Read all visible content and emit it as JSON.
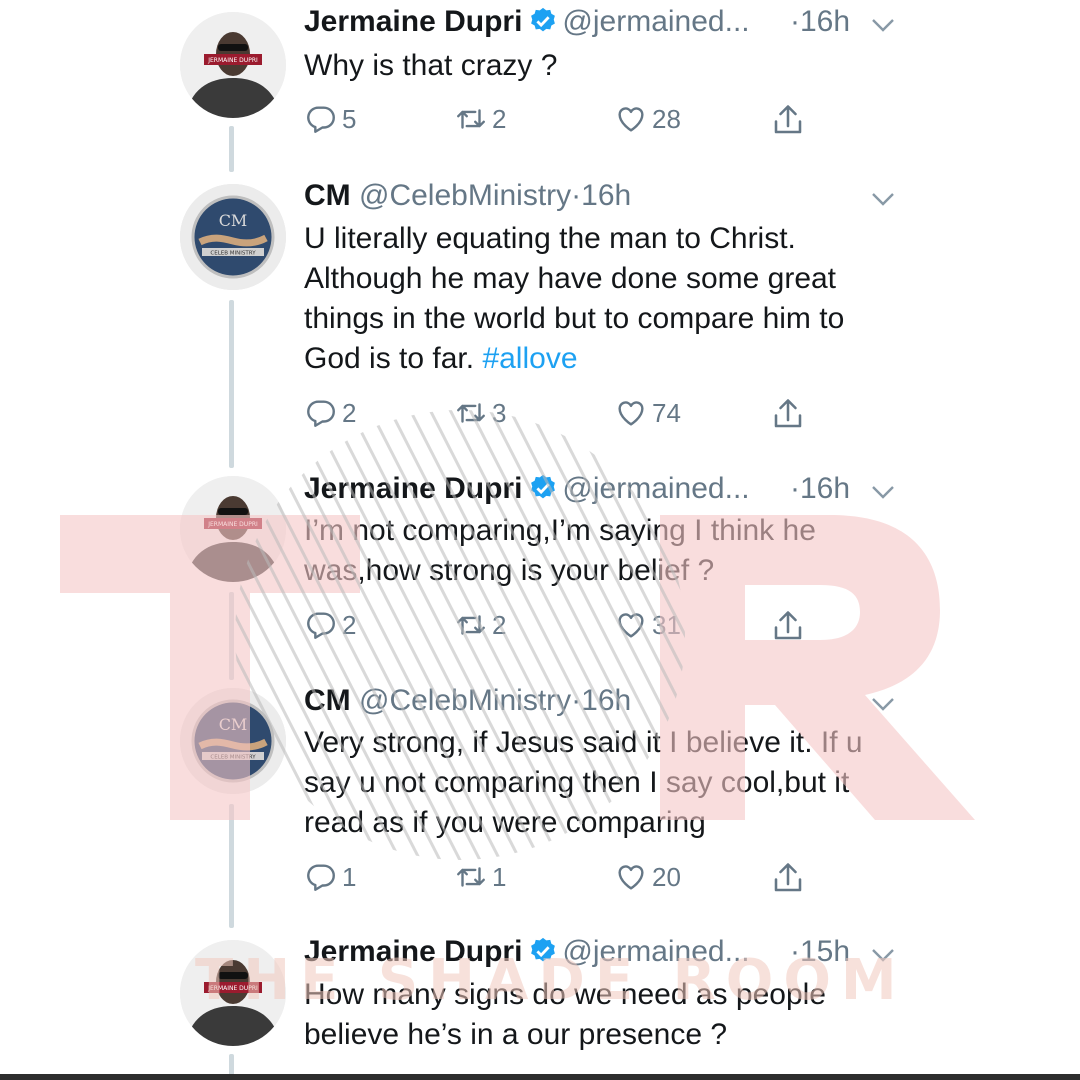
{
  "tweets": [
    {
      "name": "Jermaine Dupri",
      "handle": "@jermained...",
      "dot": "·",
      "time": "16h",
      "text": "Why is that crazy ?",
      "hashtag": "",
      "reply": "5",
      "retweet": "2",
      "like": "28",
      "avatar_text": "JERMAINE DUPRI"
    },
    {
      "name": "CM",
      "handle": "@CelebMinistry",
      "dot": "·",
      "time": "16h",
      "text": "U literally equating the man to Christ. Although he may have done some great things in the world but to compare him to God is to far.",
      "hashtag": "#allove",
      "reply": "2",
      "retweet": "3",
      "like": "74",
      "avatar_text": "CELEB MINISTRY"
    },
    {
      "name": "Jermaine Dupri",
      "handle": "@jermained...",
      "dot": "·",
      "time": "16h",
      "text": "I’m not comparing,I’m saying I think he was,how strong is your belief ?",
      "hashtag": "",
      "reply": "2",
      "retweet": "2",
      "like": "31",
      "avatar_text": "JERMAINE DUPRI"
    },
    {
      "name": "CM",
      "handle": "@CelebMinistry",
      "dot": "·",
      "time": "16h",
      "text": "Very strong, if Jesus said it I believe it. If u say u not comparing then I say cool,but it read as if you were comparing",
      "hashtag": "",
      "reply": "1",
      "retweet": "1",
      "like": "20",
      "avatar_text": "CELEB MINISTRY"
    },
    {
      "name": "Jermaine Dupri",
      "handle": "@jermained...",
      "dot": "·",
      "time": "15h",
      "text": "How many signs do we need as people believe he’s in a our presence ?",
      "hashtag": "",
      "avatar_text": "JERMAINE DUPRI"
    }
  ],
  "watermark": {
    "letters": "TSR",
    "text": "THE SHADE ROOM",
    "color": "#f5c6c6"
  },
  "colors": {
    "accent": "#1da1f2",
    "muted": "#657786",
    "thread": "#cfd9de"
  },
  "icons": [
    "reply-icon",
    "retweet-icon",
    "like-icon",
    "share-icon",
    "verified-badge-icon",
    "chevron-down-icon"
  ]
}
